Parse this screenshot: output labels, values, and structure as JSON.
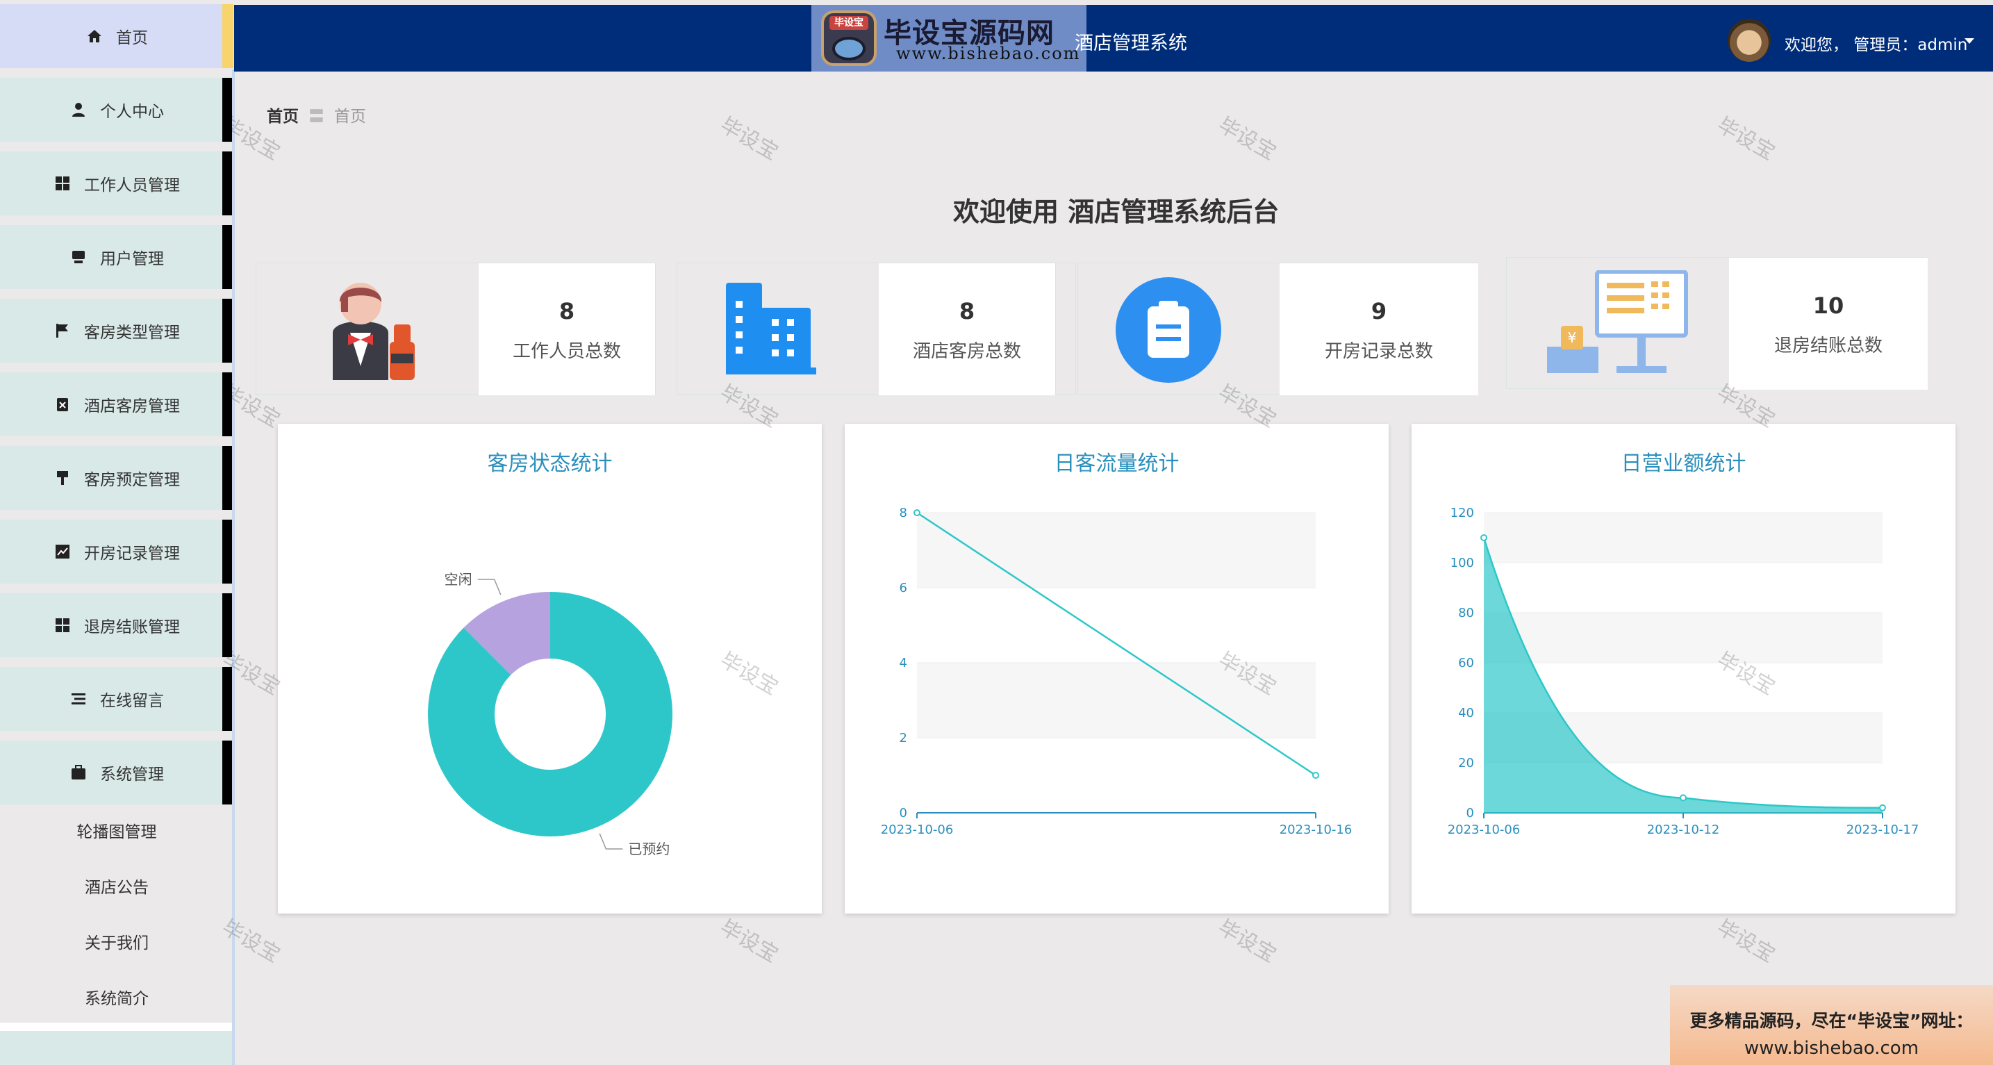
{
  "header": {
    "logo_badge": "毕设宝",
    "logo_title": "毕设宝源码网",
    "logo_url": "www.bishebao.com",
    "app_title": "酒店管理系统",
    "user_text": "欢迎您，  管理员：admin"
  },
  "sidebar": {
    "items": [
      {
        "label": "首页",
        "icon": "home-icon"
      },
      {
        "label": "个人中心",
        "icon": "user-icon"
      },
      {
        "label": "工作人员管理",
        "icon": "grid-icon"
      },
      {
        "label": "用户管理",
        "icon": "monitor-icon"
      },
      {
        "label": "客房类型管理",
        "icon": "flag-icon"
      },
      {
        "label": "酒店客房管理",
        "icon": "clipboard-x-icon"
      },
      {
        "label": "客房预定管理",
        "icon": "brush-icon"
      },
      {
        "label": "开房记录管理",
        "icon": "trend-icon"
      },
      {
        "label": "退房结账管理",
        "icon": "grid-icon"
      },
      {
        "label": "在线留言",
        "icon": "list-icon"
      },
      {
        "label": "系统管理",
        "icon": "briefcase-icon"
      }
    ],
    "sub_items": [
      "轮播图管理",
      "酒店公告",
      "关于我们",
      "系统简介"
    ]
  },
  "breadcrumb": {
    "home": "首页",
    "separator": "〓",
    "current": "首页"
  },
  "welcome": "欢迎使用 酒店管理系统后台",
  "stats": [
    {
      "value": "8",
      "label": "工作人员总数",
      "icon": "waiter-icon"
    },
    {
      "value": "8",
      "label": "酒店客房总数",
      "icon": "building-icon"
    },
    {
      "value": "9",
      "label": "开房记录总数",
      "icon": "clipboard-icon"
    },
    {
      "value": "10",
      "label": "退房结账总数",
      "icon": "cash-register-icon"
    }
  ],
  "charts": {
    "titles": [
      "客房状态统计",
      "日客流量统计",
      "日营业额统计"
    ]
  },
  "chart_data": [
    {
      "type": "pie",
      "title": "客房状态统计",
      "labels": [
        "已预约",
        "空闲"
      ],
      "values": [
        7,
        1
      ],
      "colors": [
        "#2ec7c9",
        "#b6a2de"
      ]
    },
    {
      "type": "line",
      "title": "日客流量统计",
      "x": [
        "2023-10-06",
        "2023-10-16"
      ],
      "series": [
        {
          "values": [
            8,
            1
          ]
        }
      ],
      "ylim": [
        0,
        8
      ],
      "yticks": [
        0,
        2,
        4,
        6,
        8
      ],
      "color": "#2ec7c9"
    },
    {
      "type": "area",
      "title": "日营业额统计",
      "x": [
        "2023-10-06",
        "2023-10-12",
        "2023-10-17"
      ],
      "series": [
        {
          "values": [
            110,
            6,
            2
          ]
        }
      ],
      "ylim": [
        0,
        120
      ],
      "yticks": [
        0,
        20,
        40,
        60,
        80,
        100,
        120
      ],
      "color": "#2ec7c9"
    }
  ],
  "watermark": "毕设宝",
  "promo": {
    "line1": "更多精品源码，尽在“毕设宝”网址：",
    "line2": "www.bishebao.com"
  }
}
